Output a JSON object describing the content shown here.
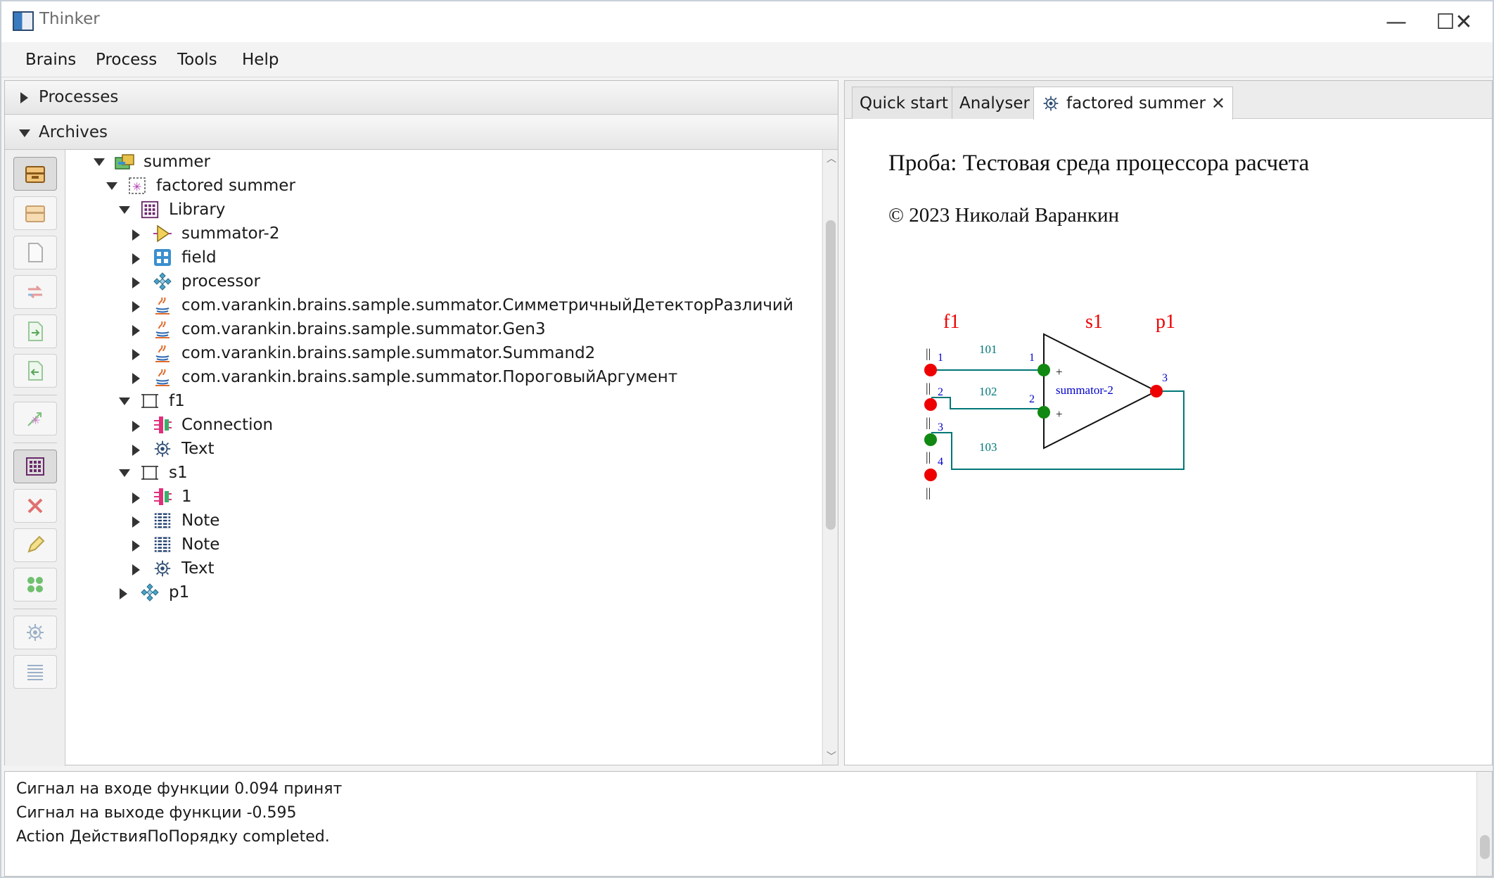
{
  "window": {
    "title": "Thinker",
    "minimize_glyph": "—",
    "maximize_glyph": "☐",
    "close_glyph": "✕"
  },
  "menu": {
    "items": [
      "Brains",
      "Process",
      "Tools",
      "Help"
    ]
  },
  "left": {
    "processes_label": "Processes",
    "archives_label": "Archives",
    "toolbar_icons": [
      "archive-open-icon",
      "archive-closed-icon",
      "document-icon",
      "transfer-icon",
      "import-icon",
      "export-icon",
      "factor-icon",
      "library-icon",
      "delete-icon",
      "edit-icon",
      "group-icon",
      "text-icon",
      "note-icon"
    ],
    "tree": [
      {
        "label": "summer",
        "level": 0,
        "expanded": true,
        "icon": "archive-box-icon"
      },
      {
        "label": "factored summer",
        "level": 1,
        "expanded": true,
        "icon": "factor-icon"
      },
      {
        "label": "Library",
        "level": 2,
        "expanded": true,
        "icon": "library-icon"
      },
      {
        "label": "summator-2",
        "level": 3,
        "expanded": false,
        "icon": "summator-icon"
      },
      {
        "label": "field",
        "level": 3,
        "expanded": false,
        "icon": "field-icon"
      },
      {
        "label": "processor",
        "level": 3,
        "expanded": false,
        "icon": "processor-icon"
      },
      {
        "label": "com.varankin.brains.sample.summator.СимметричныйДетекторРазличий",
        "level": 3,
        "expanded": false,
        "icon": "java-icon"
      },
      {
        "label": "com.varankin.brains.sample.summator.Gen3",
        "level": 3,
        "expanded": false,
        "icon": "java-icon"
      },
      {
        "label": "com.varankin.brains.sample.summator.Summand2",
        "level": 3,
        "expanded": false,
        "icon": "java-icon"
      },
      {
        "label": "com.varankin.brains.sample.summator.ПороговыйАргумент",
        "level": 3,
        "expanded": false,
        "icon": "java-icon"
      },
      {
        "label": "f1",
        "level": 2,
        "expanded": true,
        "icon": "frame-icon"
      },
      {
        "label": "Connection",
        "level": 3,
        "expanded": false,
        "icon": "connection-icon"
      },
      {
        "label": "Text",
        "level": 3,
        "expanded": false,
        "icon": "text-icon"
      },
      {
        "label": "s1",
        "level": 2,
        "expanded": true,
        "icon": "frame-icon"
      },
      {
        "label": "1",
        "level": 3,
        "expanded": false,
        "icon": "connection-icon"
      },
      {
        "label": "Note",
        "level": 3,
        "expanded": false,
        "icon": "note-icon"
      },
      {
        "label": "Note",
        "level": 3,
        "expanded": false,
        "icon": "note-icon"
      },
      {
        "label": "Text",
        "level": 3,
        "expanded": false,
        "icon": "text-icon"
      },
      {
        "label": "p1",
        "level": 2,
        "expanded": false,
        "icon": "processor-icon"
      }
    ]
  },
  "tabs": {
    "items": [
      "Quick start",
      "Analyser",
      "factored summer"
    ],
    "close_glyph": "✕"
  },
  "document": {
    "title": "Проба: Тестовая среда процессора расчета",
    "copyright": "© 2023 Николай Варанкин"
  },
  "diagram": {
    "labels": {
      "f1": "f1",
      "s1": "s1",
      "p1": "p1"
    },
    "summator_label": "summator-2",
    "plus": "+",
    "pin_marker": "||",
    "field_pins": [
      "1",
      "2",
      "3",
      "4"
    ],
    "summator_pins": [
      "1",
      "2"
    ],
    "output_pin": "3",
    "links": [
      "101",
      "102",
      "103"
    ],
    "colors": {
      "red": "#ee0000",
      "green": "#118811",
      "teal": "#007777",
      "blue": "#0000cc",
      "black": "#111111"
    }
  },
  "log": {
    "lines": [
      "Сигнал на входе функции 0.094 принят",
      "Сигнал на выходе функции -0.595",
      "Action ДействияПоПорядку completed."
    ]
  }
}
